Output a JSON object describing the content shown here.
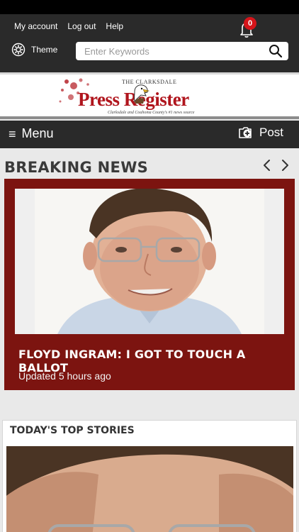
{
  "top_links": {
    "my_account": "My account",
    "log_out": "Log out",
    "help": "Help"
  },
  "notifications": {
    "count": "0",
    "icon": "bell-icon"
  },
  "theme": {
    "label": "Theme",
    "icon": "gear-icon"
  },
  "search": {
    "placeholder": "Enter Keywords",
    "icon": "search-icon"
  },
  "logo": {
    "small_text": "THE CLARKSDALE",
    "main_text": "Press Register",
    "tagline": "Clarksdale and Coahoma County's #1 news source"
  },
  "menubar": {
    "menu_label": "Menu",
    "post_label": "Post"
  },
  "breaking": {
    "section_title": "BREAKING NEWS",
    "headline": "FLOYD INGRAM: I GOT TO TOUCH A BALLOT",
    "updated": "Updated 5 hours ago"
  },
  "top_stories": {
    "section_title": "TODAY'S TOP STORIES"
  },
  "colors": {
    "header_bg": "#2a2a2a",
    "breaking_card": "#7c1410",
    "badge": "#d6141a",
    "brand_red": "#b0151d"
  }
}
